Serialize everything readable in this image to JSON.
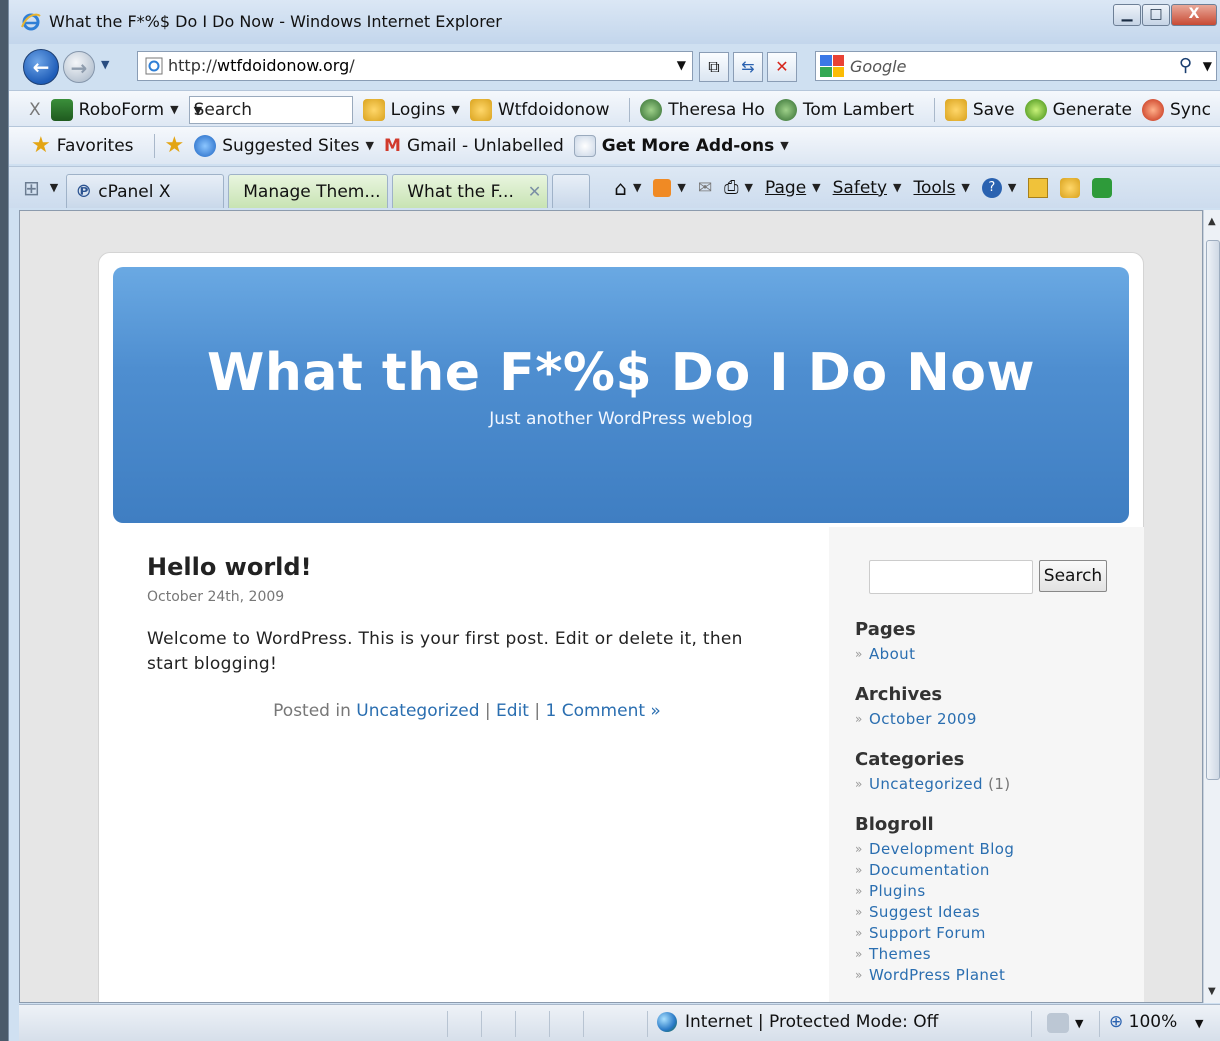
{
  "window": {
    "title": "What the F*%$ Do I Do Now - Windows Internet Explorer",
    "minimize": "▁",
    "maximize": "□",
    "close": "X"
  },
  "address_bar": {
    "url_prefix": "http://",
    "url_host": "wtfdoidonow.org",
    "url_suffix": "/",
    "search_placeholder": "Google"
  },
  "roboform_bar": {
    "close": "X",
    "roboform": "RoboForm",
    "search": "Search",
    "items": [
      "Logins",
      "Wtfdoidonow",
      "Theresa Ho",
      "Tom Lambert",
      "Save",
      "Generate",
      "Sync"
    ]
  },
  "favorites_bar": {
    "favorites": "Favorites",
    "suggested_sites": "Suggested Sites",
    "gmail": "Gmail - Unlabelled",
    "addons": "Get More Add-ons"
  },
  "tabs": [
    {
      "label": "cPanel X"
    },
    {
      "label": "Manage Them..."
    },
    {
      "label": "What the F..."
    }
  ],
  "commands": {
    "page": "Page",
    "safety": "Safety",
    "tools": "Tools"
  },
  "site": {
    "title": "What the F*%$ Do I Do Now",
    "tagline": "Just another WordPress weblog"
  },
  "post": {
    "title": "Hello world!",
    "date": "October 24th, 2009",
    "body": "Welcome to WordPress. This is your first post. Edit or delete it, then start blogging!",
    "posted_in": "Posted in",
    "category": "Uncategorized",
    "edit": "Edit",
    "comments": "1 Comment »",
    "sep": "|"
  },
  "sidebar": {
    "search_button": "Search",
    "pages_heading": "Pages",
    "pages": [
      "About"
    ],
    "archives_heading": "Archives",
    "archives": [
      "October 2009"
    ],
    "categories_heading": "Categories",
    "categories": [
      {
        "name": "Uncategorized",
        "count": "(1)"
      }
    ],
    "blogroll_heading": "Blogroll",
    "blogroll": [
      "Development Blog",
      "Documentation",
      "Plugins",
      "Suggest Ideas",
      "Support Forum",
      "Themes",
      "WordPress Planet"
    ]
  },
  "status_bar": {
    "zone": "Internet | Protected Mode: Off",
    "zoom": "100%"
  },
  "colors": {
    "header_blue": "#4e8ed0",
    "link_blue": "#2a6eb0"
  }
}
